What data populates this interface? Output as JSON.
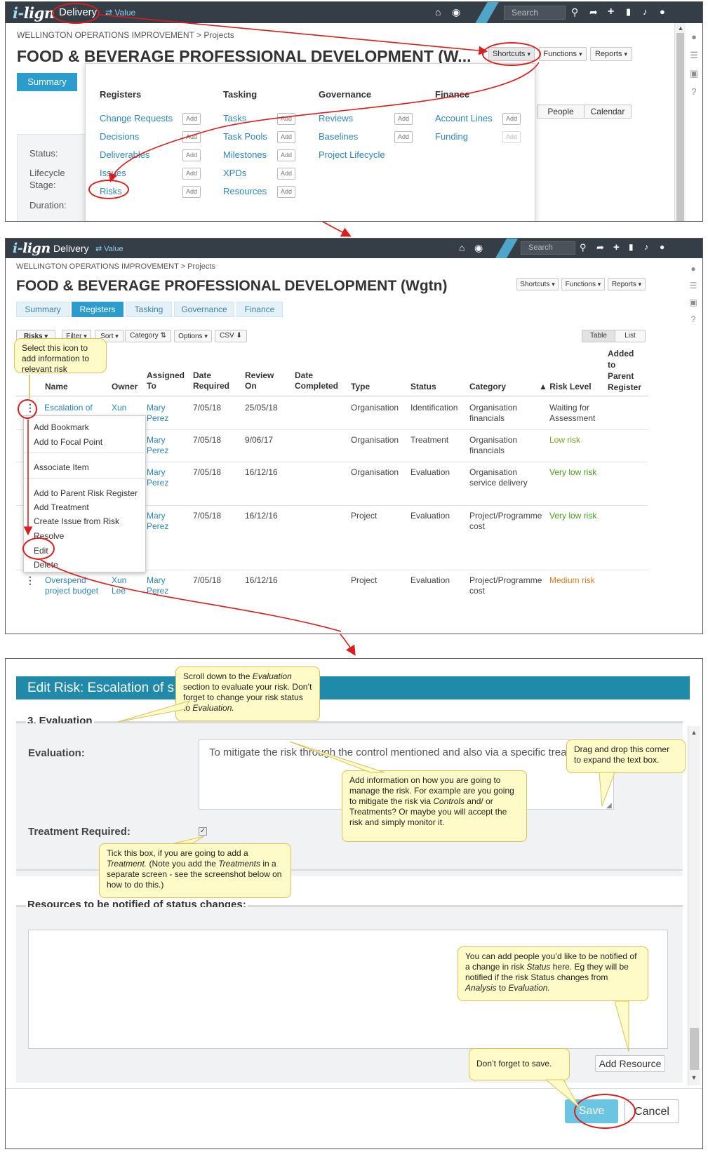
{
  "topbar": {
    "logo_prefix": "i-",
    "logo_main": "lign",
    "module": "Delivery",
    "value_label": "⇄ Value",
    "search_placeholder": "Search"
  },
  "breadcrumb": {
    "org": "WELLINGTON OPERATIONS IMPROVEMENT",
    "sep": " > ",
    "section": "Projects"
  },
  "panel1": {
    "title": "FOOD & BEVERAGE PROFESSIONAL DEVELOPMENT (W...",
    "shortcuts": "Shortcuts",
    "functions": "Functions",
    "reports": "Reports",
    "summary_tab": "Summary",
    "people": "People",
    "calendar": "Calendar",
    "status_label": "Status:",
    "lifecycle_label": "Lifecycle",
    "stage_label": "Stage:",
    "duration_label": "Duration:",
    "menu": {
      "add": "Add",
      "registers": {
        "heading": "Registers",
        "items": [
          "Change Requests",
          "Decisions",
          "Deliverables",
          "Issues",
          "Risks"
        ]
      },
      "tasking": {
        "heading": "Tasking",
        "items": [
          "Tasks",
          "Task Pools",
          "Milestones",
          "XPDs",
          "Resources"
        ]
      },
      "governance": {
        "heading": "Governance",
        "items": [
          "Reviews",
          "Baselines",
          "Project Lifecycle"
        ]
      },
      "finance": {
        "heading": "Finance",
        "items": [
          "Account Lines",
          "Funding"
        ]
      }
    }
  },
  "panel2": {
    "title": "FOOD & BEVERAGE PROFESSIONAL DEVELOPMENT (Wgtn)",
    "tabs": [
      "Summary",
      "Registers",
      "Tasking",
      "Governance",
      "Finance"
    ],
    "toolbar": {
      "risks": "Risks",
      "filter": "Filter",
      "sort": "Sort",
      "category": "Category",
      "options": "Options",
      "csv": "CSV",
      "table": "Table",
      "list": "List"
    },
    "callout": "Select this icon to add information to relevant risk",
    "columns": {
      "name": "Name",
      "owner": "Owner",
      "assigned": [
        "Assigned",
        "To"
      ],
      "required": [
        "Date",
        "Required"
      ],
      "review": [
        "Review",
        "On"
      ],
      "completed": [
        "Date",
        "Completed"
      ],
      "type": "Type",
      "status": "Status",
      "category": "Category",
      "risk_level": "▲ Risk Level",
      "parent": [
        "Added",
        "to",
        "Parent",
        "Register"
      ]
    },
    "rows": [
      {
        "name": [
          "Escalation of",
          ""
        ],
        "owner": [
          "Xun",
          ""
        ],
        "assigned": [
          "Mary",
          "Perez"
        ],
        "required": "7/05/18",
        "review": "25/05/18",
        "type": "Organisation",
        "status": "Identification",
        "category": [
          "Organisation",
          "financials"
        ],
        "risk": [
          "Waiting for",
          "Assessment"
        ],
        "risk_color": "#444444"
      },
      {
        "assigned": [
          "Mary",
          "Perez"
        ],
        "required": "7/05/18",
        "review": "9/06/17",
        "type": "Organisation",
        "status": "Treatment",
        "category": [
          "Organisation",
          "financials"
        ],
        "risk": [
          "Low risk",
          ""
        ],
        "risk_color": "#7aa31c"
      },
      {
        "assigned": [
          "Mary",
          "Perez"
        ],
        "required": "7/05/18",
        "review": "16/12/16",
        "type": "Organisation",
        "status": "Evaluation",
        "category": [
          "Organisation",
          "service delivery"
        ],
        "risk": [
          "Very low risk",
          ""
        ],
        "risk_color": "#4a9a1e"
      },
      {
        "assigned": [
          "Mary",
          "Perez"
        ],
        "required": "7/05/18",
        "review": "16/12/16",
        "type": "Project",
        "status": "Evaluation",
        "category": [
          "Project/Programme",
          "cost"
        ],
        "risk": [
          "Very low risk",
          ""
        ],
        "risk_color": "#4a9a1e"
      },
      {
        "name": [
          "Overspend",
          "project budget"
        ],
        "owner": [
          "Xun",
          "Lee"
        ],
        "assigned": [
          "Mary",
          "Perez"
        ],
        "required": "7/05/18",
        "review": "16/12/16",
        "type": "Project",
        "status": "Evaluation",
        "category": [
          "Project/Programme",
          "cost"
        ],
        "risk": [
          "Medium risk",
          ""
        ],
        "risk_color": "#e07b1f"
      }
    ],
    "menu": [
      "Add Bookmark",
      "Add to Focal Point",
      "Associate Item",
      "Add to Parent Risk Register",
      "Add Treatment",
      "Create Issue from Risk",
      "Resolve",
      "Edit",
      "Delete"
    ]
  },
  "panel3": {
    "modal_title": "Edit Risk: Escalation of s",
    "section_evaluation": "3. Evaluation",
    "evaluation_label": "Evaluation:",
    "evaluation_text": "To mitigate the risk through the control mentioned and also via a specific treatment.",
    "treatment_label": "Treatment Required:",
    "resources_section": "Resources to be notified of status changes:",
    "add_resource": "Add Resource",
    "save": "Save",
    "cancel": "Cancel",
    "callouts": {
      "scroll": [
        "Scroll down to the ",
        "Evaluation",
        " section to evaluate your risk. Don’t forget to change your risk status to ",
        "Evaluation."
      ],
      "drag": "Drag and drop this corner to expand the text box.",
      "manage": [
        "Add information on how you are going to manage the risk.  For example are you going to mitigate the risk via ",
        "Controls",
        " and/ or Treatments? Or maybe you will  accept the risk and simply monitor it."
      ],
      "tick": [
        "Tick this box, if you are going to add a ",
        "Treatment.",
        "  (Note you add the ",
        "Treatments",
        " in a separate screen - see the screenshot below on how to do this.)"
      ],
      "notify": [
        "You can add people you’d like to be notified of a change in risk ",
        "Status",
        " here. Eg they will be notified if the risk Status changes from ",
        "Analysis",
        " to ",
        "Evaluation."
      ],
      "save": "Don’t forget to save."
    }
  },
  "colors": {
    "topbar": "#353d47",
    "accent": "#2b9ccc",
    "modal_header": "#1f8aaa",
    "annotation": "#d81e1e",
    "callout_bg": "#fffbc8"
  }
}
